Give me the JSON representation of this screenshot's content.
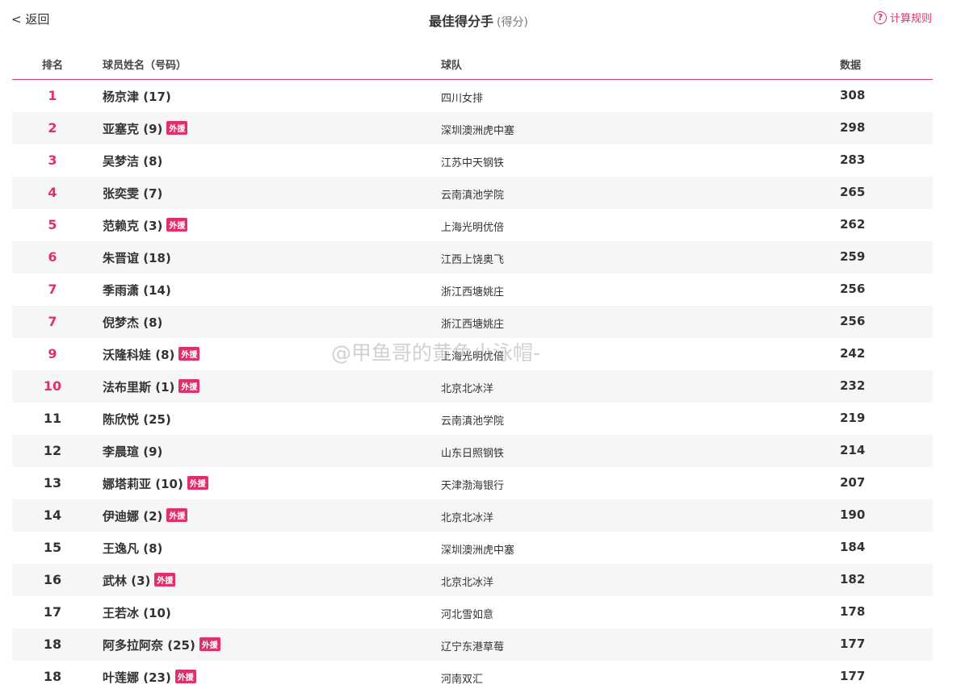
{
  "header": {
    "back_label": "< 返回",
    "title": "最佳得分手",
    "subtitle": "(得分)",
    "rules_label": "计算规则",
    "rules_icon": "?"
  },
  "columns": {
    "rank": "排名",
    "name": "球员姓名（号码）",
    "team": "球队",
    "value": "数据"
  },
  "badge_label": "外援",
  "rows": [
    {
      "rank": "1",
      "name": "杨京津 (17)",
      "foreign": false,
      "team": "四川女排",
      "value": "308"
    },
    {
      "rank": "2",
      "name": "亚塞克 (9)",
      "foreign": true,
      "team": "深圳澳洲虎中塞",
      "value": "298"
    },
    {
      "rank": "3",
      "name": "吴梦洁 (8)",
      "foreign": false,
      "team": "江苏中天钢铁",
      "value": "283"
    },
    {
      "rank": "4",
      "name": "张奕雯 (7)",
      "foreign": false,
      "team": "云南滇池学院",
      "value": "265"
    },
    {
      "rank": "5",
      "name": "范赖克 (3)",
      "foreign": true,
      "team": "上海光明优倍",
      "value": "262"
    },
    {
      "rank": "6",
      "name": "朱晋谊 (18)",
      "foreign": false,
      "team": "江西上饶奥飞",
      "value": "259"
    },
    {
      "rank": "7",
      "name": "季雨潇 (14)",
      "foreign": false,
      "team": "浙江西塘姚庄",
      "value": "256"
    },
    {
      "rank": "7",
      "name": "倪梦杰 (8)",
      "foreign": false,
      "team": "浙江西塘姚庄",
      "value": "256"
    },
    {
      "rank": "9",
      "name": "沃隆科娃 (8)",
      "foreign": true,
      "team": "上海光明优倍",
      "value": "242"
    },
    {
      "rank": "10",
      "name": "法布里斯 (1)",
      "foreign": true,
      "team": "北京北冰洋",
      "value": "232"
    },
    {
      "rank": "11",
      "name": "陈欣悦 (25)",
      "foreign": false,
      "team": "云南滇池学院",
      "value": "219"
    },
    {
      "rank": "12",
      "name": "李晨瑄 (9)",
      "foreign": false,
      "team": "山东日照钢铁",
      "value": "214"
    },
    {
      "rank": "13",
      "name": "娜塔莉亚 (10)",
      "foreign": true,
      "team": "天津渤海银行",
      "value": "207"
    },
    {
      "rank": "14",
      "name": "伊迪娜 (2)",
      "foreign": true,
      "team": "北京北冰洋",
      "value": "190"
    },
    {
      "rank": "15",
      "name": "王逸凡 (8)",
      "foreign": false,
      "team": "深圳澳洲虎中塞",
      "value": "184"
    },
    {
      "rank": "16",
      "name": "武林 (3)",
      "foreign": true,
      "team": "北京北冰洋",
      "value": "182"
    },
    {
      "rank": "17",
      "name": "王若冰 (10)",
      "foreign": false,
      "team": "河北雪如意",
      "value": "178"
    },
    {
      "rank": "18",
      "name": "阿多拉阿奈 (25)",
      "foreign": true,
      "team": "辽宁东港草莓",
      "value": "177"
    },
    {
      "rank": "18",
      "name": "叶莲娜 (23)",
      "foreign": true,
      "team": "河南双汇",
      "value": "177"
    }
  ],
  "watermark": "@甲鱼哥的黄色小泳帽-"
}
